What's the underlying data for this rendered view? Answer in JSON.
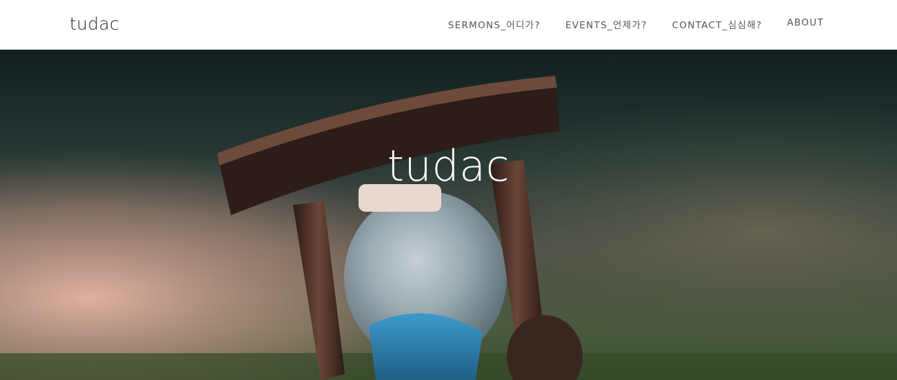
{
  "header": {
    "logo": "tudac",
    "nav": [
      {
        "label": "SERMONS_어디가?"
      },
      {
        "label": "EVENTS_언제가?"
      },
      {
        "label": "CONTACT_심심해?"
      },
      {
        "label": "ABOUT"
      }
    ]
  },
  "hero": {
    "title": "tudac",
    "image_subject": "hourglass-photo"
  },
  "colors": {
    "header_bg": "#ffffff",
    "nav_text": "#555555",
    "hero_title": "#ffffff",
    "sand": "#2f86b7"
  }
}
